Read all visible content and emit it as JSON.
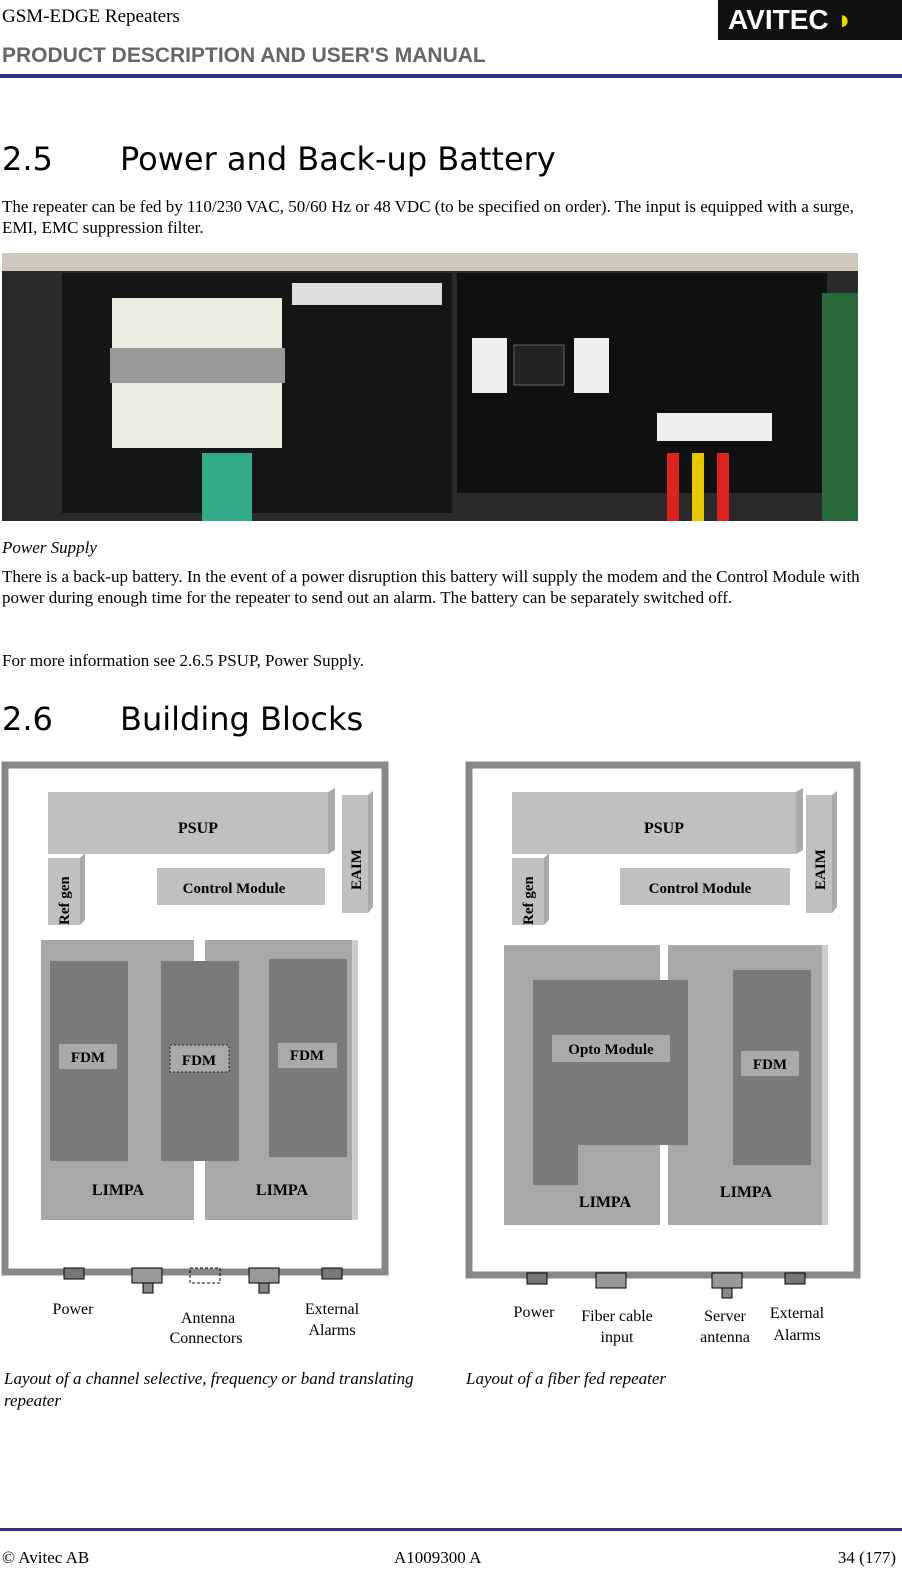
{
  "header": {
    "doc_type": "GSM-EDGE Repeaters",
    "manual_title": "PRODUCT DESCRIPTION AND USER'S MANUAL",
    "logo_text": "AVITEC"
  },
  "section_2_5": {
    "number": "2.5",
    "title": "Power and Back-up Battery",
    "intro": "The repeater can be fed by 110/230 VAC, 50/60 Hz or 48 VDC (to be specified on order). The input is equipped with a surge, EMI, EMC suppression filter.",
    "photo_caption": "Power Supply",
    "para1": "There is a back-up battery. In the event of a power disruption this battery will supply the modem and the Control Module with power during enough time for the repeater to send out an alarm. The battery can be separately switched off.",
    "para2": "For more information see 2.6.5  PSUP, Power Supply."
  },
  "section_2_6": {
    "number": "2.6",
    "title": "Building Blocks"
  },
  "diagram_left": {
    "psup": "PSUP",
    "ref_gen": "Ref gen",
    "control_module": "Control Module",
    "eaim": "EAIM",
    "fdm": "FDM",
    "limpa": "LIMPA",
    "power": "Power",
    "antenna_1": "Antenna",
    "antenna_2": "Connectors",
    "ext_1": "External",
    "ext_2": "Alarms",
    "caption": "Layout of a  channel selective, frequency or band translating repeater"
  },
  "diagram_right": {
    "psup": "PSUP",
    "ref_gen": "Ref gen",
    "control_module": "Control Module",
    "eaim": "EAIM",
    "opto": "Opto Module",
    "fdm": "FDM",
    "limpa": "LIMPA",
    "power": "Power",
    "fiber_1": "Fiber cable",
    "fiber_2": "input",
    "server_1": "Server",
    "server_2": "antenna",
    "ext_1": "External",
    "ext_2": "Alarms",
    "caption": "Layout of a fiber fed repeater"
  },
  "footer": {
    "company": "© Avitec AB",
    "doc_number": "A1009300 A",
    "page": "34 (177)"
  }
}
